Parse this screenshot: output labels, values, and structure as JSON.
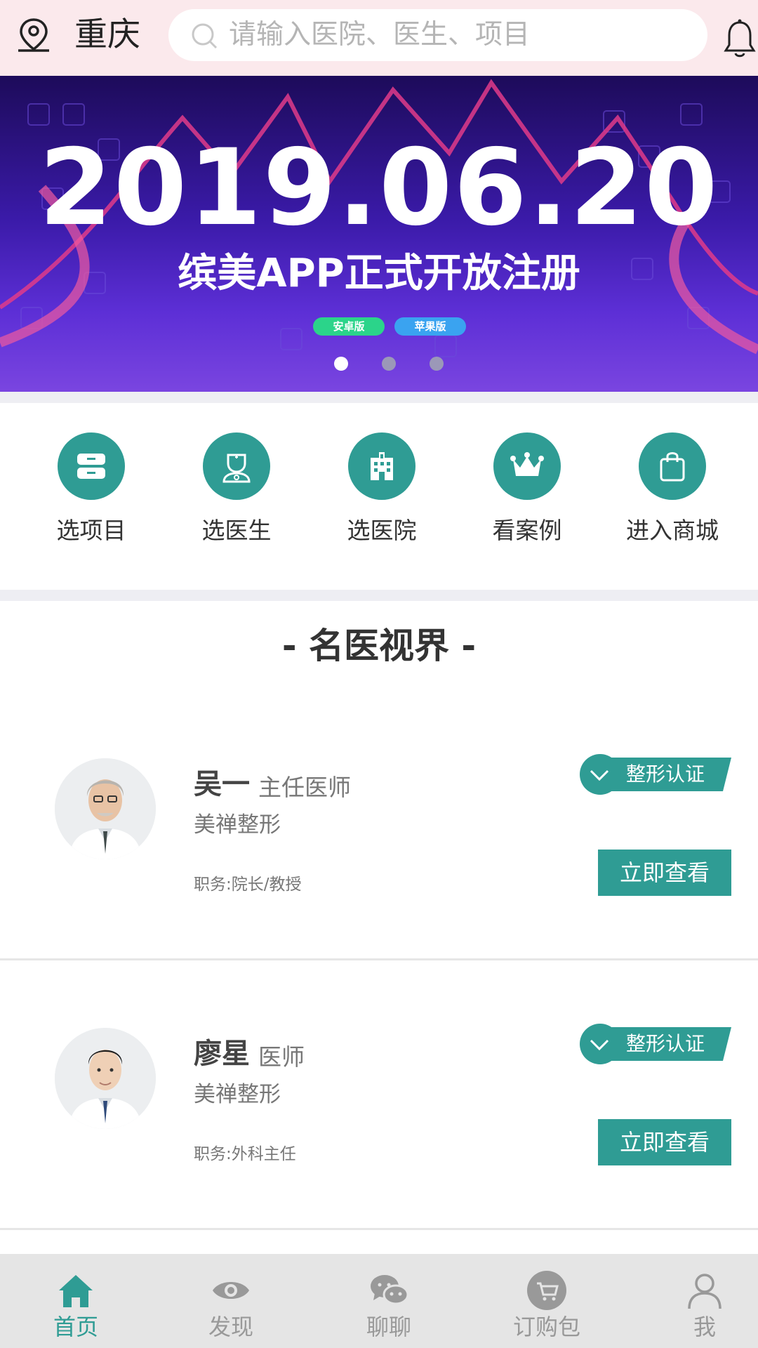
{
  "header": {
    "city": "重庆",
    "search_placeholder": "请输入医院、医生、项目",
    "icons": [
      "location-pin-icon",
      "search-icon",
      "bell-icon"
    ]
  },
  "banner": {
    "date": "2019.06.20",
    "subtitle": "缤美APP正式开放注册",
    "android_badge": "安卓版",
    "ios_badge": "苹果版",
    "slide_count": 3,
    "active_slide": 1
  },
  "categories": [
    {
      "label": "选项目",
      "icon": "drawer-icon"
    },
    {
      "label": "选医生",
      "icon": "doctor-icon"
    },
    {
      "label": "选医院",
      "icon": "hospital-icon"
    },
    {
      "label": "看案例",
      "icon": "crown-icon"
    },
    {
      "label": "进入商城",
      "icon": "shopping-bag-icon"
    }
  ],
  "section": {
    "title": "- 名医视界 -"
  },
  "doctors": [
    {
      "name": "吴一",
      "title": "主任医师",
      "hospital": "美禅整形",
      "duty": "职务:院长/教授",
      "badge": "整形认证",
      "button": "立即查看"
    },
    {
      "name": "廖星",
      "title": "医师",
      "hospital": "美禅整形",
      "duty": "职务:外科主任",
      "badge": "整形认证",
      "button": "立即查看"
    }
  ],
  "tabbar": {
    "active": "首页",
    "tabs": [
      {
        "label": "首页",
        "icon": "home-icon"
      },
      {
        "label": "发现",
        "icon": "eye-icon"
      },
      {
        "label": "聊聊",
        "icon": "chat-icon"
      },
      {
        "label": "订购包",
        "icon": "cart-icon"
      },
      {
        "label": "我",
        "icon": "user-icon"
      }
    ]
  },
  "colors": {
    "header_bg": "#fbe9ec",
    "accent": "#2f9c94",
    "separator": "#eeeef3",
    "tabbar_bg": "#e5e5e5"
  }
}
